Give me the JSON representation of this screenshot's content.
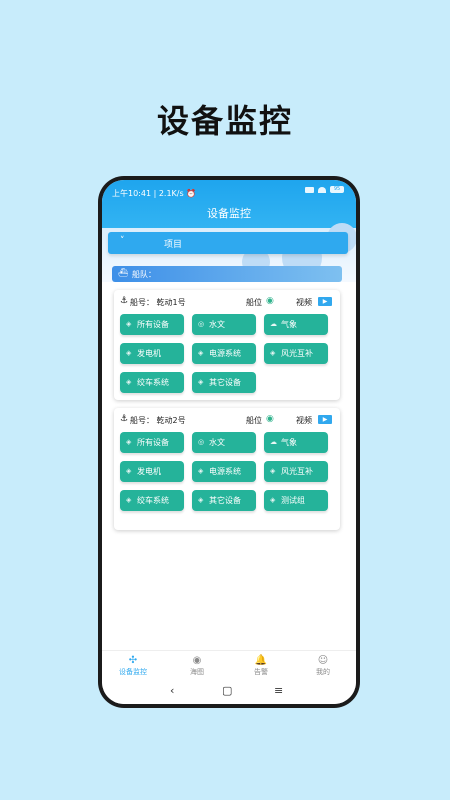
{
  "headline": "设备监控",
  "status": {
    "time_text": "上午10:41 | 2.1K/s ⏰",
    "battery": "95"
  },
  "app_title": "设备监控",
  "project": {
    "chevron": "˅",
    "label": "项目"
  },
  "fleet": {
    "label": "船队："
  },
  "ships": [
    {
      "ship_no": "船号：  乾动1号",
      "position_label": "船位",
      "video_label": "视频",
      "buttons": [
        {
          "icon": "◈",
          "label": "所有设备"
        },
        {
          "icon": "◎",
          "label": "水文"
        },
        {
          "icon": "☁",
          "label": "气象"
        },
        {
          "icon": "◈",
          "label": "发电机"
        },
        {
          "icon": "◈",
          "label": "电源系统"
        },
        {
          "icon": "◈",
          "label": "风光互补"
        },
        {
          "icon": "◈",
          "label": "绞车系统"
        },
        {
          "icon": "◈",
          "label": "其它设备"
        }
      ]
    },
    {
      "ship_no": "船号：  乾动2号",
      "position_label": "船位",
      "video_label": "视频",
      "buttons": [
        {
          "icon": "◈",
          "label": "所有设备"
        },
        {
          "icon": "◎",
          "label": "水文"
        },
        {
          "icon": "☁",
          "label": "气象"
        },
        {
          "icon": "◈",
          "label": "发电机"
        },
        {
          "icon": "◈",
          "label": "电源系统"
        },
        {
          "icon": "◈",
          "label": "风光互补"
        },
        {
          "icon": "◈",
          "label": "绞车系统"
        },
        {
          "icon": "◈",
          "label": "其它设备"
        },
        {
          "icon": "◈",
          "label": "测试组"
        }
      ]
    }
  ],
  "tabs": [
    {
      "icon": "✣",
      "label": "设备监控"
    },
    {
      "icon": "◉",
      "label": "海图"
    },
    {
      "icon": "🔔",
      "label": "告警"
    },
    {
      "icon": "☺",
      "label": "我的"
    }
  ],
  "nav": {
    "back": "‹",
    "home": "▢",
    "menu": "≡"
  },
  "colors": {
    "accent": "#2fa9ef",
    "button": "#25b39a",
    "background": "#c8ecfb"
  }
}
